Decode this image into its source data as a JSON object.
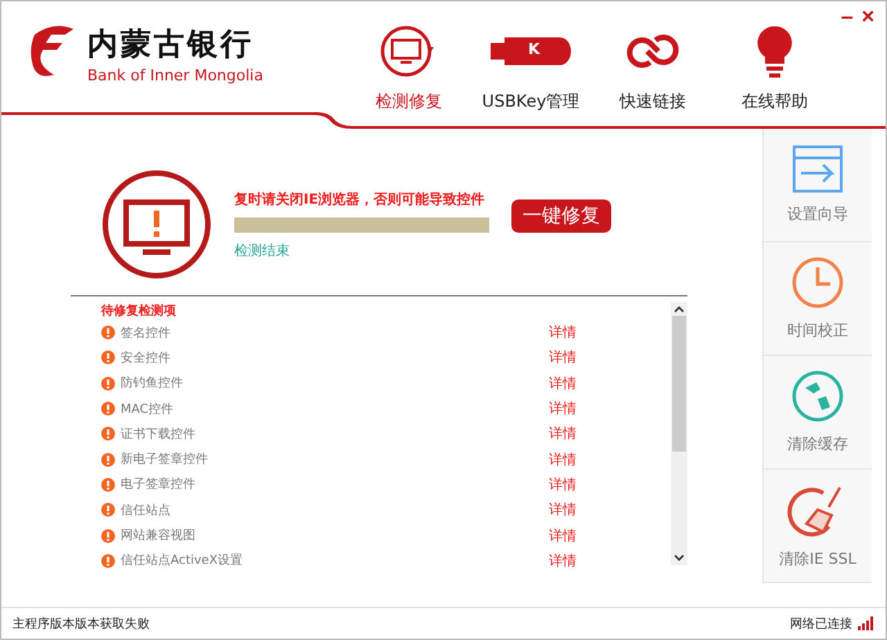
{
  "header": {
    "logo_cn": "内蒙古银行",
    "logo_en": "Bank of Inner Mongolia",
    "window_controls": [
      "–",
      "×"
    ],
    "nav": [
      {
        "label": "检测修复",
        "kind": "monitor",
        "selected": true
      },
      {
        "label": "USBKey管理",
        "kind": "usbkey",
        "key_letter": "K",
        "selected": false
      },
      {
        "label": "快速链接",
        "kind": "link",
        "selected": false
      },
      {
        "label": "在线帮助",
        "kind": "bulb",
        "selected": false
      }
    ]
  },
  "status_panel": {
    "warning": "复时请关闭IE浏览器，否则可能导致控件",
    "progress": {
      "level": 1
    },
    "result": "检测结束",
    "repair_button": "一键修复"
  },
  "list": {
    "heading": "待修复检测项",
    "items": [
      {
        "name": "签名控件",
        "detail": "详情"
      },
      {
        "name": "安全控件",
        "detail": "详情"
      },
      {
        "name": "防钓鱼控件",
        "detail": "详情"
      },
      {
        "name": "MAC控件",
        "detail": "详情"
      },
      {
        "name": "证书下载控件",
        "detail": "详情"
      },
      {
        "name": "新电子签章控件",
        "detail": "详情"
      },
      {
        "name": "电子签章控件",
        "detail": "详情"
      },
      {
        "name": "信任站点",
        "detail": "详情"
      },
      {
        "name": "网站兼容视图",
        "detail": "详情"
      },
      {
        "name": "信任站点ActiveX设置",
        "detail": "详情"
      }
    ]
  },
  "tools": [
    {
      "label": "设置向导",
      "kind": "wizard"
    },
    {
      "label": "时间校正",
      "kind": "clock"
    },
    {
      "label": "清除缓存",
      "kind": "globe"
    },
    {
      "label": "清除IE SSL",
      "kind": "broom"
    }
  ],
  "status_bar": {
    "left": "主程序版本版本获取失败",
    "right": "网络已连接"
  }
}
